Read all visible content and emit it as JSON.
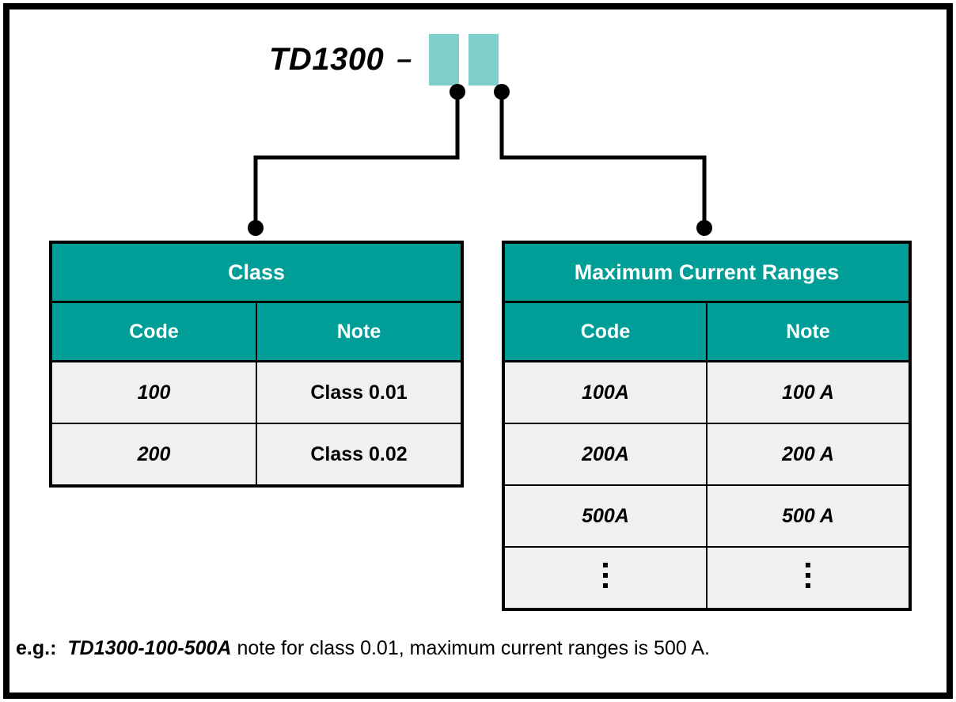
{
  "diagram": {
    "model": {
      "name": "TD1300",
      "separator": "–",
      "slots": [
        "class-code-slot",
        "current-range-code-slot"
      ]
    },
    "accent_color_header": "#009e97",
    "accent_color_slot": "#7ececa",
    "row_background": "#f0f0f0",
    "tables": [
      {
        "id": "class-table",
        "title": "Class",
        "columns": [
          "Code",
          "Note"
        ],
        "rows": [
          {
            "code": "100",
            "note": "Class 0.01"
          },
          {
            "code": "200",
            "note": "Class 0.02"
          }
        ]
      },
      {
        "id": "current-ranges-table",
        "title": "Maximum Current Ranges",
        "columns": [
          "Code",
          "Note"
        ],
        "rows": [
          {
            "code": "100A",
            "note": "100 A"
          },
          {
            "code": "200A",
            "note": "200 A"
          },
          {
            "code": "500A",
            "note": "500 A"
          },
          {
            "code": "⋮",
            "note": "⋮"
          }
        ]
      }
    ],
    "caption": {
      "prefix": "e.g.:",
      "example_code": "TD1300-100-500A",
      "text": "note for class 0.01, maximum current ranges is 500 A."
    }
  }
}
